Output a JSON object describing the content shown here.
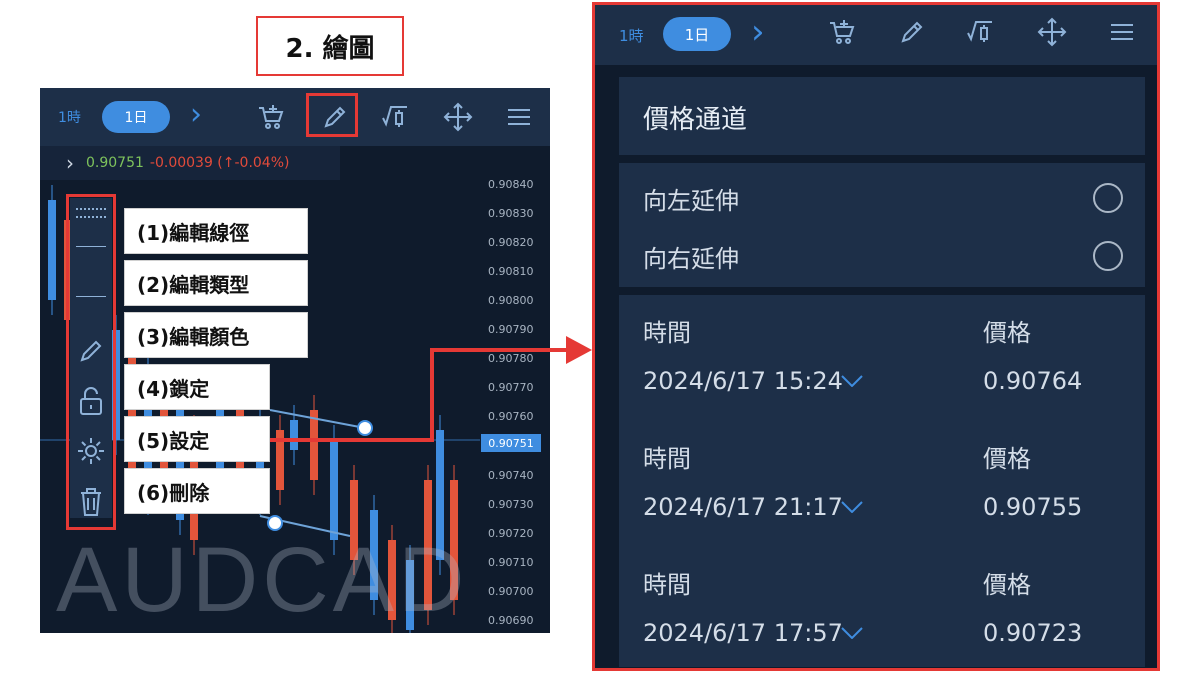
{
  "title": "2. 繪圖",
  "toolbar": {
    "tf_1h": "1時",
    "tf_1d": "1日",
    "next": "›"
  },
  "quote": {
    "price": "0.90751",
    "change": "-0.00039 (↑-0.04%)"
  },
  "y_axis": [
    "0.90840",
    "0.90830",
    "0.90820",
    "0.90810",
    "0.90800",
    "0.90790",
    "0.90780",
    "0.90770",
    "0.90760",
    "0.90740",
    "0.90730",
    "0.90720",
    "0.90710",
    "0.90700",
    "0.90690"
  ],
  "current_price": "0.90751",
  "watermark": "AUDCAD",
  "callouts": [
    "(1)編輯線徑",
    "(2)編輯類型",
    "(3)編輯顏色",
    "(4)鎖定",
    "(5)設定",
    "(6)刪除"
  ],
  "panel": {
    "section_title": "價格通道",
    "extend_left": "向左延伸",
    "extend_right": "向右延伸",
    "points": [
      {
        "time_label": "時間",
        "time": "2024/6/17 15:24",
        "price_label": "價格",
        "price": "0.90764"
      },
      {
        "time_label": "時間",
        "time": "2024/6/17 21:17",
        "price_label": "價格",
        "price": "0.90755"
      },
      {
        "time_label": "時間",
        "time": "2024/6/17 17:57",
        "price_label": "價格",
        "price": "0.90723"
      }
    ]
  },
  "colors": {
    "accent": "#3f8de0",
    "highlight": "#e53935",
    "up": "#3f8de0",
    "down": "#e2553b"
  }
}
